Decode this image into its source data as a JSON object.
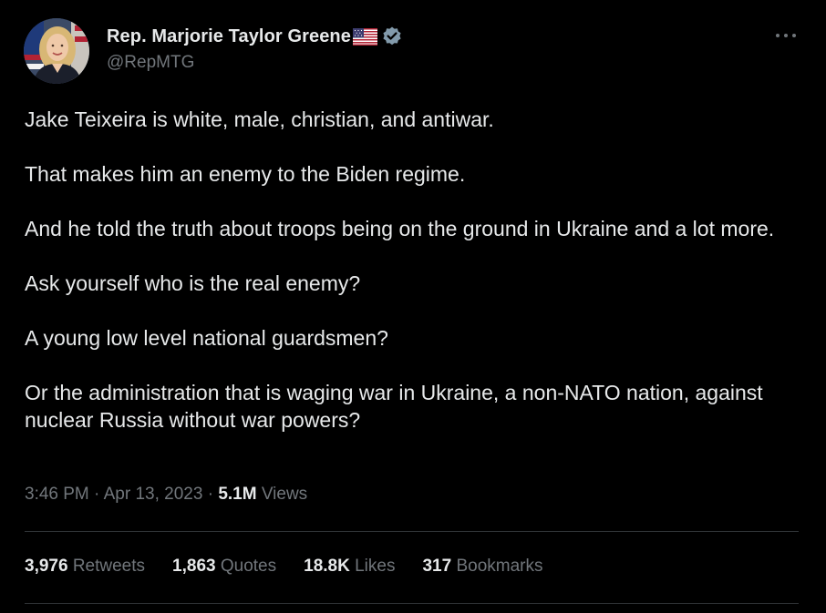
{
  "author": {
    "display_name": "Rep. Marjorie Taylor Greene",
    "handle": "@RepMTG",
    "flag_icon": "us-flag-icon",
    "verified_icon": "verified-badge-icon",
    "verified_color": "#829aab"
  },
  "tweet": {
    "paragraphs": [
      "Jake Teixeira is white, male, christian, and antiwar.",
      "That makes him an enemy to the Biden regime.",
      "And he told the truth about troops being on the ground in Ukraine and a lot more.",
      "Ask yourself who is the real enemy?",
      "A young low level national guardsmen?",
      "Or the administration that is waging war in Ukraine, a non-NATO nation, against nuclear Russia without war powers?"
    ]
  },
  "meta": {
    "time": "3:46 PM",
    "separator": " · ",
    "date": "Apr 13, 2023",
    "views_count": "5.1M",
    "views_label": " Views"
  },
  "stats": {
    "retweets": {
      "count": "3,976",
      "label": " Retweets"
    },
    "quotes": {
      "count": "1,863",
      "label": " Quotes"
    },
    "likes": {
      "count": "18.8K",
      "label": " Likes"
    },
    "bookmarks": {
      "count": "317",
      "label": " Bookmarks"
    }
  },
  "more_icon": "more-horizontal-icon",
  "colors": {
    "background": "#000000",
    "text": "#e7e9ea",
    "secondary_text": "#71767b",
    "divider": "#2f3336"
  }
}
